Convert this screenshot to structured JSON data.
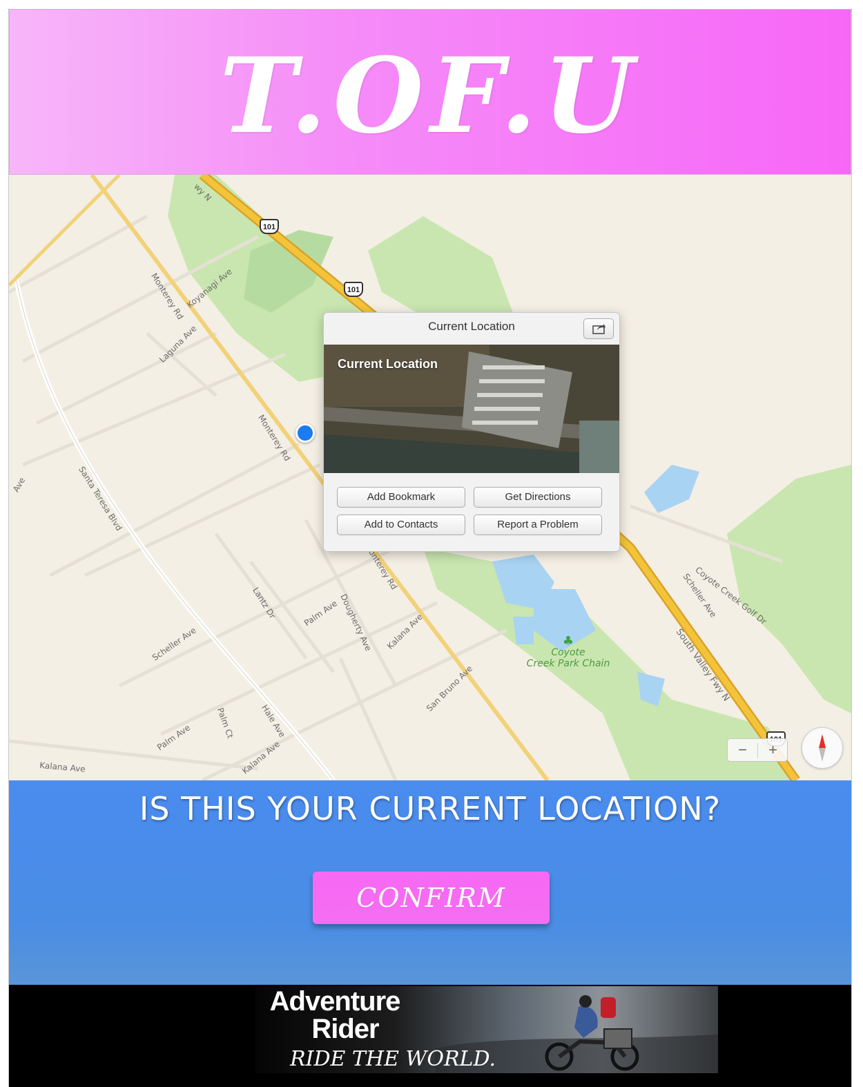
{
  "header": {
    "logo_text": "T.OF.U"
  },
  "map": {
    "road_labels": {
      "monterey_rd_1": "Monterey Rd",
      "monterey_rd_2": "Monterey Rd",
      "monterey_rd_3": "onterey Rd",
      "laguna_ave": "Laguna Ave",
      "koyanagi_ave": "Koyanagi Ave",
      "santa_teresa": "Santa Teresa Blvd",
      "lantz_dr": "Lantz Dr",
      "palm_ave_1": "Palm Ave",
      "palm_ave_2": "Palm Ave",
      "palm_ct": "Palm Ct",
      "dougherty_ave": "Dougherty Ave",
      "kalana_ave_1": "Kalana Ave",
      "kalana_ave_2": "Kalana Ave",
      "kalana_ave_3": "Kalana Ave",
      "scheller_ave_1": "Scheller Ave",
      "scheller_ave_2": "Scheller Ave",
      "hale_ave": "Hale Ave",
      "san_bruno_ave": "San Bruno Ave",
      "coyote_creek_golf": "Coyote Creek Golf Dr",
      "south_valley_fwy": "South Valley Fwy N",
      "fwy_n": "wy N",
      "ave_edge": "Ave"
    },
    "shields": [
      "101",
      "101",
      "101"
    ],
    "park_label_line1": "Coyote",
    "park_label_line2": "Creek Park Chain",
    "zoom_out": "−",
    "zoom_in": "+",
    "popup": {
      "title": "Current Location",
      "photo_label": "Current Location",
      "buttons": {
        "add_bookmark": "Add Bookmark",
        "get_directions": "Get Directions",
        "add_to_contacts": "Add to Contacts",
        "report_problem": "Report a Problem"
      }
    },
    "colors": {
      "land": "#f4efe4",
      "park": "#c9e6b0",
      "water": "#a9d3f2",
      "highway": "#f3c43a"
    }
  },
  "prompt": {
    "question": "IS THIS YOUR CURRENT LOCATION?",
    "confirm_label": "CONFIRM"
  },
  "ad": {
    "line1": "Adventure",
    "line2": "Rider",
    "line3": "RIDE THE WORLD."
  }
}
